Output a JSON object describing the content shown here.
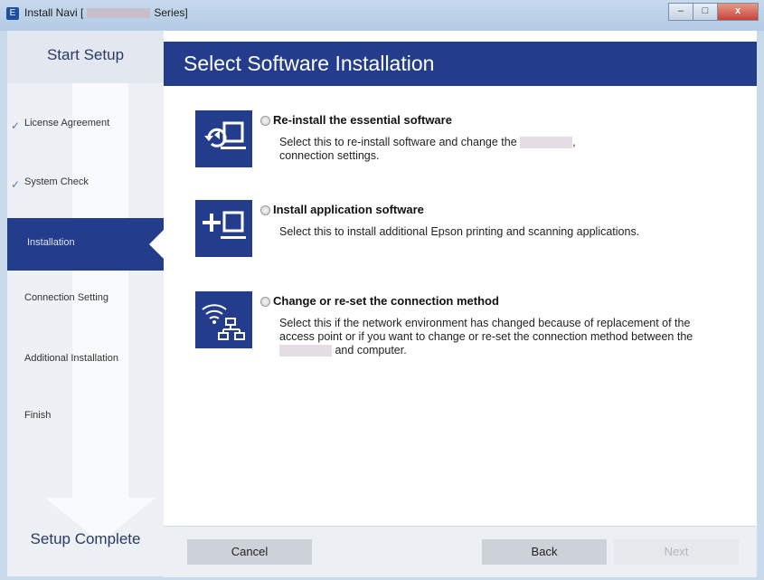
{
  "window": {
    "title_prefix": "Install Navi [",
    "title_suffix": "Series]",
    "minimize": "–",
    "maximize": "□",
    "close": "x"
  },
  "sidebar": {
    "top_label": "Start Setup",
    "bottom_label": "Setup Complete",
    "steps": [
      {
        "label": "License Agreement",
        "done": true
      },
      {
        "label": "System Check",
        "done": true
      },
      {
        "label": "Installation",
        "active": true
      },
      {
        "label": "Connection Setting"
      },
      {
        "label": "Additional Installation"
      },
      {
        "label": "Finish"
      }
    ],
    "check_glyph": "✓"
  },
  "main": {
    "header": "Select Software Installation",
    "options": [
      {
        "title": "Re-install the essential software",
        "desc_a": "Select this to re-install software and change the",
        "desc_b": ",",
        "desc_c": "connection settings."
      },
      {
        "title": "Install application software",
        "desc": "Select this to install additional Epson printing and scanning applications."
      },
      {
        "title": "Change or re-set the connection method",
        "desc_a": "Select this if the network environment has changed because of replacement of the access point or if you want to change or re-set the connection method between the",
        "desc_b": "and computer."
      }
    ]
  },
  "footer": {
    "cancel": "Cancel",
    "back": "Back",
    "next": "Next"
  },
  "colors": {
    "accent": "#233d8c",
    "sidebar_bg": "#edf0f5"
  }
}
